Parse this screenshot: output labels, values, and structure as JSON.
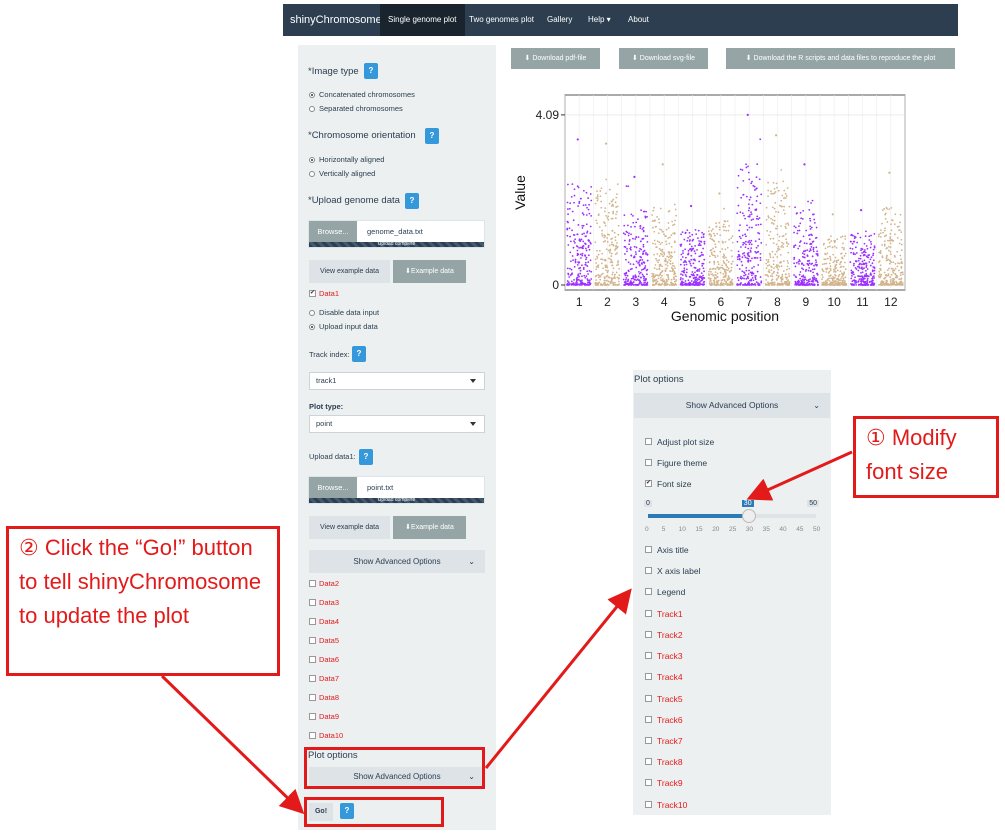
{
  "nav": {
    "brand": "shinyChromosome",
    "items": [
      "Single genome plot",
      "Two genomes plot",
      "Gallery",
      "Help ▾",
      "About"
    ]
  },
  "sidebar": {
    "image_type": {
      "label": "*Image type",
      "options": [
        "Concatenated chromosomes",
        "Separated chromosomes"
      ],
      "selected": 0
    },
    "orientation": {
      "label": "*Chromosome orientation",
      "options": [
        "Horizontally aligned",
        "Vertically aligned"
      ],
      "selected": 0
    },
    "upload_genome": {
      "label": "*Upload genome data",
      "browse": "Browse...",
      "file": "genome_data.txt",
      "status": "Upload complete"
    },
    "view_example": "View example data",
    "example_data": "Example data",
    "data1": "Data1",
    "data_mode": {
      "options": [
        "Disable data input",
        "Upload input data"
      ],
      "selected": 1
    },
    "track_index": {
      "label": "Track index:",
      "value": "track1"
    },
    "plot_type": {
      "label": "Plot type:",
      "value": "point"
    },
    "upload_data1": {
      "label": "Upload data1:",
      "browse": "Browse...",
      "file": "point.txt",
      "status": "Upload complete"
    },
    "show_advanced": "Show Advanced Options",
    "data_items": [
      "Data2",
      "Data3",
      "Data4",
      "Data5",
      "Data6",
      "Data7",
      "Data8",
      "Data9",
      "Data10"
    ],
    "plot_options": "Plot options",
    "go": "Go!",
    "help": "?"
  },
  "downloads": [
    "Download pdf-file",
    "Download svg-file",
    "Download the R scripts and data files to reproduce the plot"
  ],
  "chart_data": {
    "type": "scatter",
    "xlabel": "Genomic position",
    "ylabel": "Value",
    "yticks": [
      "0",
      "4.09"
    ],
    "ylim": [
      0,
      4.4
    ],
    "categories": [
      "1",
      "2",
      "3",
      "4",
      "5",
      "6",
      "7",
      "8",
      "9",
      "10",
      "11",
      "12"
    ],
    "colors": [
      "#9b30ff",
      "#d2b48c"
    ],
    "series": [
      {
        "values": [
          3.5,
          3.4,
          2.6,
          2.9,
          1.9,
          2.2,
          4.09,
          3.6,
          2.9,
          1.7,
          1.8,
          2.7
        ]
      }
    ]
  },
  "plot_options_panel": {
    "title": "Plot options",
    "show_advanced": "Show Advanced Options",
    "options": [
      {
        "label": "Adjust plot size",
        "checked": false,
        "red": false
      },
      {
        "label": "Figure theme",
        "checked": false,
        "red": false
      },
      {
        "label": "Font size",
        "checked": true,
        "red": false
      },
      {
        "label": "Axis title",
        "checked": false,
        "red": false
      },
      {
        "label": "X axis label",
        "checked": false,
        "red": false
      },
      {
        "label": "Legend",
        "checked": false,
        "red": false
      },
      {
        "label": "Track1",
        "checked": false,
        "red": true
      },
      {
        "label": "Track2",
        "checked": false,
        "red": true
      },
      {
        "label": "Track3",
        "checked": false,
        "red": true
      },
      {
        "label": "Track4",
        "checked": false,
        "red": true
      },
      {
        "label": "Track5",
        "checked": false,
        "red": true
      },
      {
        "label": "Track6",
        "checked": false,
        "red": true
      },
      {
        "label": "Track7",
        "checked": false,
        "red": true
      },
      {
        "label": "Track8",
        "checked": false,
        "red": true
      },
      {
        "label": "Track9",
        "checked": false,
        "red": true
      },
      {
        "label": "Track10",
        "checked": false,
        "red": true
      }
    ],
    "slider": {
      "min": 0,
      "max": 50,
      "value": 30,
      "min_label": "0",
      "max_label": "50",
      "value_label": "30",
      "ticks": [
        "0",
        "5",
        "10",
        "15",
        "20",
        "25",
        "30",
        "35",
        "40",
        "45",
        "50"
      ]
    }
  },
  "callouts": {
    "modify": "① Modify font size",
    "go": "② Click the “Go!” button to tell shinyChromosome to update the plot"
  }
}
